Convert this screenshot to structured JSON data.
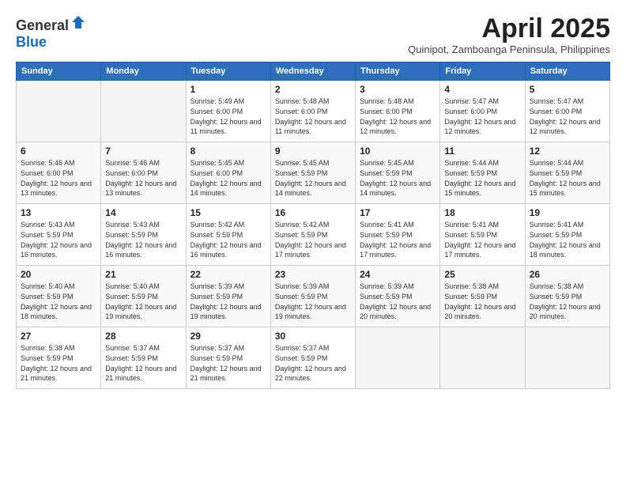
{
  "logo": {
    "general": "General",
    "blue": "Blue"
  },
  "title": "April 2025",
  "subtitle": "Quinipot, Zamboanga Peninsula, Philippines",
  "weekdays": [
    "Sunday",
    "Monday",
    "Tuesday",
    "Wednesday",
    "Thursday",
    "Friday",
    "Saturday"
  ],
  "weeks": [
    [
      {
        "day": "",
        "info": ""
      },
      {
        "day": "",
        "info": ""
      },
      {
        "day": "1",
        "info": "Sunrise: 5:49 AM\nSunset: 6:00 PM\nDaylight: 12 hours and 11 minutes."
      },
      {
        "day": "2",
        "info": "Sunrise: 5:48 AM\nSunset: 6:00 PM\nDaylight: 12 hours and 11 minutes."
      },
      {
        "day": "3",
        "info": "Sunrise: 5:48 AM\nSunset: 6:00 PM\nDaylight: 12 hours and 12 minutes."
      },
      {
        "day": "4",
        "info": "Sunrise: 5:47 AM\nSunset: 6:00 PM\nDaylight: 12 hours and 12 minutes."
      },
      {
        "day": "5",
        "info": "Sunrise: 5:47 AM\nSunset: 6:00 PM\nDaylight: 12 hours and 12 minutes."
      }
    ],
    [
      {
        "day": "6",
        "info": "Sunrise: 5:46 AM\nSunset: 6:00 PM\nDaylight: 12 hours and 13 minutes."
      },
      {
        "day": "7",
        "info": "Sunrise: 5:46 AM\nSunset: 6:00 PM\nDaylight: 12 hours and 13 minutes."
      },
      {
        "day": "8",
        "info": "Sunrise: 5:45 AM\nSunset: 6:00 PM\nDaylight: 12 hours and 14 minutes."
      },
      {
        "day": "9",
        "info": "Sunrise: 5:45 AM\nSunset: 5:59 PM\nDaylight: 12 hours and 14 minutes."
      },
      {
        "day": "10",
        "info": "Sunrise: 5:45 AM\nSunset: 5:59 PM\nDaylight: 12 hours and 14 minutes."
      },
      {
        "day": "11",
        "info": "Sunrise: 5:44 AM\nSunset: 5:59 PM\nDaylight: 12 hours and 15 minutes."
      },
      {
        "day": "12",
        "info": "Sunrise: 5:44 AM\nSunset: 5:59 PM\nDaylight: 12 hours and 15 minutes."
      }
    ],
    [
      {
        "day": "13",
        "info": "Sunrise: 5:43 AM\nSunset: 5:59 PM\nDaylight: 12 hours and 16 minutes."
      },
      {
        "day": "14",
        "info": "Sunrise: 5:43 AM\nSunset: 5:59 PM\nDaylight: 12 hours and 16 minutes."
      },
      {
        "day": "15",
        "info": "Sunrise: 5:42 AM\nSunset: 5:59 PM\nDaylight: 12 hours and 16 minutes."
      },
      {
        "day": "16",
        "info": "Sunrise: 5:42 AM\nSunset: 5:59 PM\nDaylight: 12 hours and 17 minutes."
      },
      {
        "day": "17",
        "info": "Sunrise: 5:41 AM\nSunset: 5:59 PM\nDaylight: 12 hours and 17 minutes."
      },
      {
        "day": "18",
        "info": "Sunrise: 5:41 AM\nSunset: 5:59 PM\nDaylight: 12 hours and 17 minutes."
      },
      {
        "day": "19",
        "info": "Sunrise: 5:41 AM\nSunset: 5:59 PM\nDaylight: 12 hours and 18 minutes."
      }
    ],
    [
      {
        "day": "20",
        "info": "Sunrise: 5:40 AM\nSunset: 5:59 PM\nDaylight: 12 hours and 18 minutes."
      },
      {
        "day": "21",
        "info": "Sunrise: 5:40 AM\nSunset: 5:59 PM\nDaylight: 12 hours and 19 minutes."
      },
      {
        "day": "22",
        "info": "Sunrise: 5:39 AM\nSunset: 5:59 PM\nDaylight: 12 hours and 19 minutes."
      },
      {
        "day": "23",
        "info": "Sunrise: 5:39 AM\nSunset: 5:59 PM\nDaylight: 12 hours and 19 minutes."
      },
      {
        "day": "24",
        "info": "Sunrise: 5:39 AM\nSunset: 5:59 PM\nDaylight: 12 hours and 20 minutes."
      },
      {
        "day": "25",
        "info": "Sunrise: 5:38 AM\nSunset: 5:59 PM\nDaylight: 12 hours and 20 minutes."
      },
      {
        "day": "26",
        "info": "Sunrise: 5:38 AM\nSunset: 5:59 PM\nDaylight: 12 hours and 20 minutes."
      }
    ],
    [
      {
        "day": "27",
        "info": "Sunrise: 5:38 AM\nSunset: 5:59 PM\nDaylight: 12 hours and 21 minutes."
      },
      {
        "day": "28",
        "info": "Sunrise: 5:37 AM\nSunset: 5:59 PM\nDaylight: 12 hours and 21 minutes."
      },
      {
        "day": "29",
        "info": "Sunrise: 5:37 AM\nSunset: 5:59 PM\nDaylight: 12 hours and 21 minutes."
      },
      {
        "day": "30",
        "info": "Sunrise: 5:37 AM\nSunset: 5:59 PM\nDaylight: 12 hours and 22 minutes."
      },
      {
        "day": "",
        "info": ""
      },
      {
        "day": "",
        "info": ""
      },
      {
        "day": "",
        "info": ""
      }
    ]
  ]
}
